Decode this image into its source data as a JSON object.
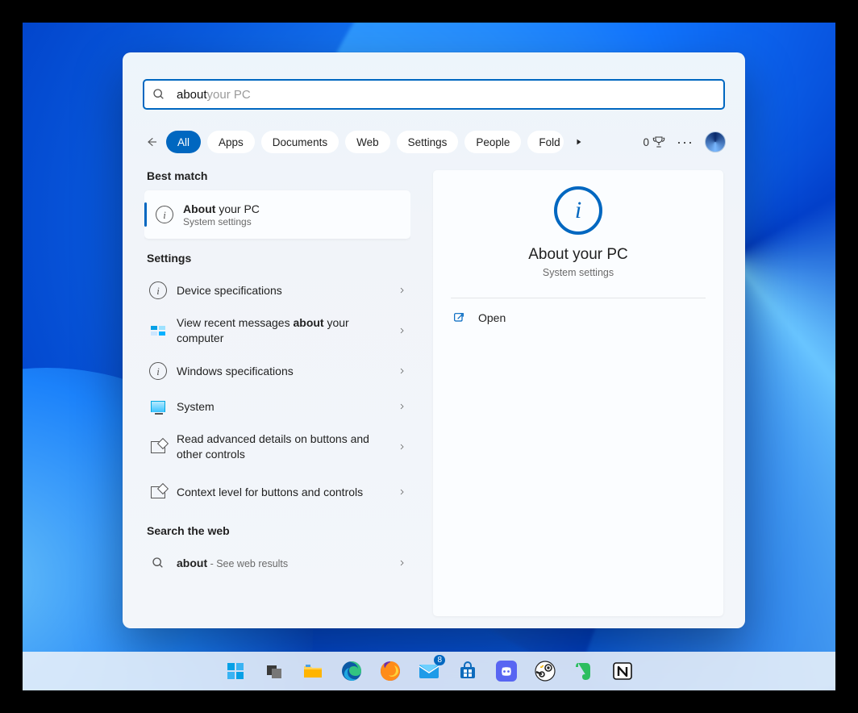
{
  "search": {
    "typed": "about",
    "autocomplete": " your PC"
  },
  "filters": {
    "items": [
      "All",
      "Apps",
      "Documents",
      "Web",
      "Settings",
      "People",
      "Folders"
    ],
    "active_index": 0,
    "points": "0"
  },
  "best_match": {
    "heading": "Best match",
    "title_bold": "About",
    "title_rest": " your PC",
    "subtitle": "System settings"
  },
  "settings": {
    "heading": "Settings",
    "items": [
      {
        "icon": "info",
        "label": "Device specifications",
        "bold": ""
      },
      {
        "icon": "flag",
        "label_pre": "View recent messages ",
        "label_bold": "about",
        "label_post": " your computer",
        "two": true
      },
      {
        "icon": "info",
        "label": "Windows specifications",
        "bold": ""
      },
      {
        "icon": "monitor",
        "label": "System",
        "bold": ""
      },
      {
        "icon": "access",
        "label": "Read advanced details on buttons and other controls",
        "two": true
      },
      {
        "icon": "access",
        "label": "Context level for buttons and controls",
        "two": true
      }
    ]
  },
  "web": {
    "heading": "Search the web",
    "term": "about",
    "suffix": " - See web results"
  },
  "detail": {
    "title": "About your PC",
    "subtitle": "System settings",
    "open_label": "Open"
  },
  "taskbar": {
    "items": [
      "start",
      "taskview",
      "explorer",
      "edge",
      "firefox",
      "mail",
      "store",
      "discord",
      "steam",
      "evernote",
      "notion"
    ],
    "mail_badge": "8"
  }
}
